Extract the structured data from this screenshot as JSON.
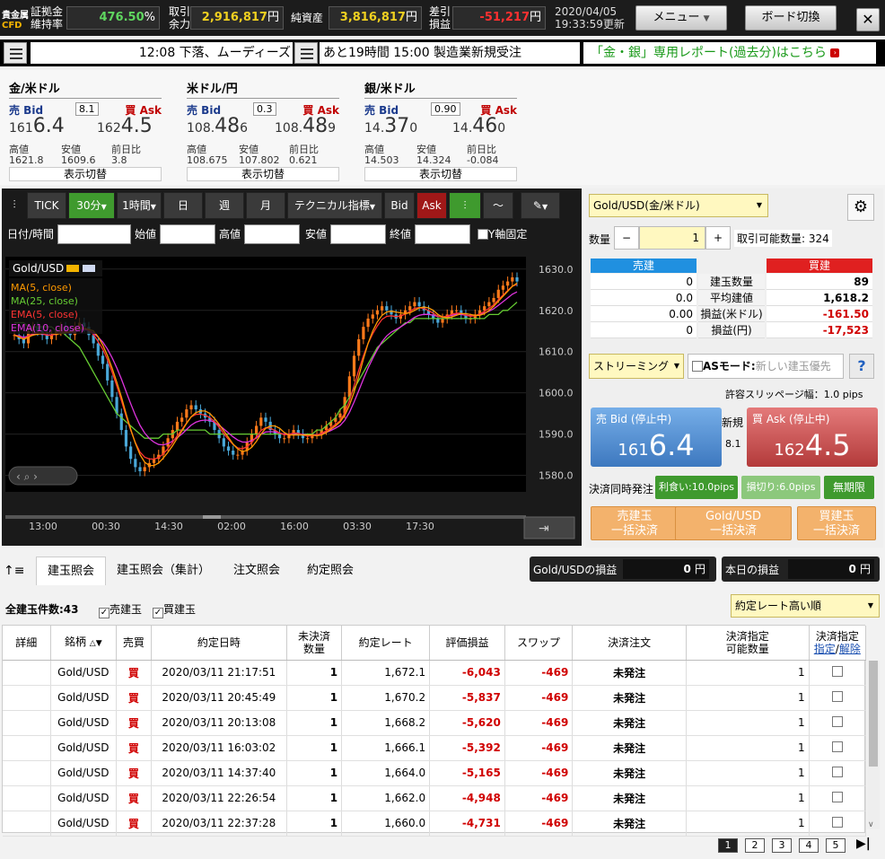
{
  "topbar": {
    "logo_top": "貴金属",
    "logo_bottom": "CFD",
    "margin_label_1": "証拠金",
    "margin_label_2": "維持率",
    "margin_value": "476.50",
    "margin_unit": "%",
    "avail_label_1": "取引",
    "avail_label_2": "余力",
    "avail_value": "2,916,817",
    "avail_unit": "円",
    "assets_label": "純資産",
    "assets_value": "3,816,817",
    "assets_unit": "円",
    "pnl_label_1": "差引",
    "pnl_label_2": "損益",
    "pnl_value": "-51,217",
    "pnl_unit": "円",
    "date": "2020/04/05",
    "time": "19:33:59更新",
    "menu_label": "メニュー",
    "board_label": "ボード切換",
    "close": "✕"
  },
  "ticker": {
    "news_1": "12:08 下落、ムーディーズ",
    "news_2": "あと19時間 15:00 製造業新規受注",
    "report": "「金・銀」専用レポート(過去分)はこちら"
  },
  "quotes": [
    {
      "title": "金/米ドル",
      "bid_label": "売 Bid",
      "ask_label": "買 Ask",
      "spread": "8.1",
      "bid_pre": "161",
      "bid_big": "6.4",
      "bid_small": "",
      "ask_pre": "162",
      "ask_big": "4.5",
      "ask_small": "",
      "high_label": "高値",
      "low_label": "安値",
      "chg_label": "前日比",
      "high": "1621.8",
      "low": "1609.6",
      "chg": "3.8",
      "toggle": "表示切替"
    },
    {
      "title": "米ドル/円",
      "bid_label": "売 Bid",
      "ask_label": "買 Ask",
      "spread": "0.3",
      "bid_pre": "108.",
      "bid_big": "48",
      "bid_small": "6",
      "ask_pre": "108.",
      "ask_big": "48",
      "ask_small": "9",
      "high_label": "高値",
      "low_label": "安値",
      "chg_label": "前日比",
      "high": "108.675",
      "low": "107.802",
      "chg": "0.621",
      "toggle": "表示切替"
    },
    {
      "title": "銀/米ドル",
      "bid_label": "売 Bid",
      "ask_label": "買 Ask",
      "spread": "0.90",
      "bid_pre": "14.",
      "bid_big": "37",
      "bid_small": "0",
      "ask_pre": "14.",
      "ask_big": "46",
      "ask_small": "0",
      "high_label": "高値",
      "low_label": "安値",
      "chg_label": "前日比",
      "high": "14.503",
      "low": "14.324",
      "chg": "-0.084",
      "toggle": "表示切替"
    }
  ],
  "chart_toolbar": {
    "tick": "TICK",
    "m30": "30分",
    "h1": "1時間",
    "day": "日",
    "week": "週",
    "month": "月",
    "technical": "テクニカル指標",
    "bid": "Bid",
    "ask": "Ask"
  },
  "chart_filters": {
    "datetime": "日付/時間",
    "open": "始値",
    "high": "高値",
    "low": "安値",
    "close": "終値",
    "yfix": "Y軸固定"
  },
  "chart_data": {
    "type": "candlestick",
    "symbol": "Gold/USD",
    "legend": [
      "MA(5, close)",
      "MA(25, close)",
      "EMA(5, close)",
      "EMA(10, close)"
    ],
    "legend_colors": [
      "#ff9900",
      "#66cc33",
      "#ff3333",
      "#dd33dd"
    ],
    "ylim": [
      1576,
      1633
    ],
    "yticks": [
      "1630.0",
      "1620.0",
      "1610.0",
      "1600.0",
      "1590.0",
      "1580.0"
    ],
    "xticks": [
      "13:00",
      "00:30",
      "14:30",
      "02:00",
      "16:00",
      "03:30",
      "17:30"
    ],
    "close": [
      1614,
      1613,
      1612,
      1615,
      1616,
      1615,
      1614,
      1613,
      1614,
      1615,
      1616,
      1615,
      1614,
      1616,
      1617,
      1616,
      1614,
      1612,
      1609,
      1607,
      1603,
      1599,
      1595,
      1591,
      1587,
      1584,
      1582,
      1581,
      1582,
      1583,
      1584,
      1585,
      1587,
      1589,
      1591,
      1593,
      1594,
      1596,
      1597,
      1596,
      1595,
      1594,
      1593,
      1591,
      1589,
      1587,
      1586,
      1585,
      1585,
      1586,
      1588,
      1590,
      1592,
      1594,
      1593,
      1591,
      1590,
      1589,
      1589,
      1590,
      1591,
      1590,
      1589,
      1589,
      1590,
      1590,
      1591,
      1592,
      1593,
      1594,
      1595,
      1599,
      1604,
      1609,
      1613,
      1616,
      1618,
      1619,
      1620,
      1621,
      1620,
      1619,
      1618,
      1619,
      1620,
      1621,
      1622,
      1621,
      1620,
      1619,
      1618,
      1617,
      1618,
      1619,
      1620,
      1620,
      1619,
      1618,
      1618,
      1619,
      1620,
      1621,
      1622,
      1623,
      1625,
      1626,
      1627,
      1628,
      1627
    ],
    "ma25": [
      1617,
      1617,
      1617,
      1616,
      1616,
      1616,
      1616,
      1616,
      1616,
      1615,
      1615,
      1614,
      1613,
      1612,
      1611,
      1609,
      1607,
      1605,
      1603,
      1601,
      1599,
      1597,
      1595,
      1594,
      1593,
      1592,
      1591,
      1590,
      1589,
      1589,
      1589,
      1589,
      1590,
      1590,
      1590,
      1591,
      1591,
      1591,
      1591,
      1591,
      1591,
      1591,
      1590,
      1590,
      1590,
      1590,
      1590,
      1590,
      1590,
      1590,
      1590,
      1590,
      1590,
      1590,
      1590,
      1590,
      1590,
      1590,
      1590,
      1590,
      1590,
      1590,
      1590,
      1590,
      1590,
      1591,
      1591,
      1592,
      1593,
      1594,
      1596,
      1597,
      1599,
      1601,
      1603,
      1605,
      1607,
      1609,
      1611,
      1612,
      1613,
      1614,
      1615,
      1616,
      1617,
      1617,
      1618,
      1618,
      1618,
      1618,
      1618,
      1618,
      1618,
      1618,
      1618,
      1618,
      1618,
      1618,
      1618,
      1618,
      1618,
      1618,
      1619,
      1619,
      1619,
      1620,
      1620,
      1621,
      1622
    ]
  },
  "right_panel": {
    "product": "Gold/USD(金/米ドル)",
    "qty_label": "数量",
    "qty_minus": "−",
    "qty_value": "1",
    "qty_plus": "+",
    "available_label": "取引可能数量:",
    "available_value": "324",
    "sell_head": "売建",
    "buy_head": "買建",
    "rows": [
      {
        "label": "建玉数量",
        "sell": "0",
        "buy": "89"
      },
      {
        "label": "平均建値",
        "sell": "0.0",
        "buy": "1,618.2"
      },
      {
        "label": "損益(米ドル)",
        "sell": "0.00",
        "buy": "-161.50"
      },
      {
        "label": "損益(円)",
        "sell": "0",
        "buy": "-17,523"
      }
    ],
    "streaming": "ストリーミング",
    "as_mode": "ASモード:",
    "as_placeholder": "新しい建玉優先",
    "help": "?",
    "slippage": "許容スリッページ幅：1.0 pips",
    "bid_title": "売 Bid (停止中)",
    "bid_pre": "161",
    "bid_big": "6.4",
    "new_label": "新規",
    "spread": "8.1",
    "ask_title": "買 Ask (停止中)",
    "ask_pre": "162",
    "ask_big": "4.5",
    "settle_label": "決済同時発注",
    "take_profit": "利食い:10.0pips",
    "stop_loss": "損切り:6.0pips",
    "no_limit": "無期限",
    "bulk_sell_1": "売建玉",
    "bulk_sell_2": "一括決済",
    "bulk_prod_1": "Gold/USD",
    "bulk_prod_2": "一括決済",
    "bulk_buy_1": "買建玉",
    "bulk_buy_2": "一括決済"
  },
  "tabs": [
    "建玉照会",
    "建玉照会（集計）",
    "注文照会",
    "約定照会"
  ],
  "pnl_box": {
    "product_label": "Gold/USDの損益",
    "product_value": "0",
    "today_label": "本日の損益",
    "today_value": "0",
    "unit": "円"
  },
  "filters": {
    "total": "全建玉件数:43",
    "sell": "売建玉",
    "buy": "買建玉",
    "sort": "約定レート高い順"
  },
  "table": {
    "headers": [
      "詳細",
      "銘柄",
      "売買",
      "約定日時",
      "未決済\n数量",
      "約定レート",
      "評価損益",
      "スワップ",
      "決済注文",
      "決済指定\n可能数量",
      "決済指定"
    ],
    "hdr_specify": "指定",
    "hdr_cancel": "解除",
    "rows": [
      {
        "name": "Gold/USD",
        "side": "買",
        "date": "2020/03/11 21:17:51",
        "qty": "1",
        "rate": "1,672.1",
        "pnl": "-6,043",
        "swap": "-469",
        "order": "未発注",
        "avail": "1"
      },
      {
        "name": "Gold/USD",
        "side": "買",
        "date": "2020/03/11 20:45:49",
        "qty": "1",
        "rate": "1,670.2",
        "pnl": "-5,837",
        "swap": "-469",
        "order": "未発注",
        "avail": "1"
      },
      {
        "name": "Gold/USD",
        "side": "買",
        "date": "2020/03/11 20:13:08",
        "qty": "1",
        "rate": "1,668.2",
        "pnl": "-5,620",
        "swap": "-469",
        "order": "未発注",
        "avail": "1"
      },
      {
        "name": "Gold/USD",
        "side": "買",
        "date": "2020/03/11 16:03:02",
        "qty": "1",
        "rate": "1,666.1",
        "pnl": "-5,392",
        "swap": "-469",
        "order": "未発注",
        "avail": "1"
      },
      {
        "name": "Gold/USD",
        "side": "買",
        "date": "2020/03/11 14:37:40",
        "qty": "1",
        "rate": "1,664.0",
        "pnl": "-5,165",
        "swap": "-469",
        "order": "未発注",
        "avail": "1"
      },
      {
        "name": "Gold/USD",
        "side": "買",
        "date": "2020/03/11 22:26:54",
        "qty": "1",
        "rate": "1,662.0",
        "pnl": "-4,948",
        "swap": "-469",
        "order": "未発注",
        "avail": "1"
      },
      {
        "name": "Gold/USD",
        "side": "買",
        "date": "2020/03/11 22:37:28",
        "qty": "1",
        "rate": "1,660.0",
        "pnl": "-4,731",
        "swap": "-469",
        "order": "未発注",
        "avail": "1"
      }
    ]
  },
  "pagination": [
    "1",
    "2",
    "3",
    "4",
    "5"
  ],
  "colors": {
    "accent_green": "#3f9a2e",
    "bid_blue": "#4a86c8",
    "ask_red": "#c84040",
    "negative": "#d00000"
  }
}
